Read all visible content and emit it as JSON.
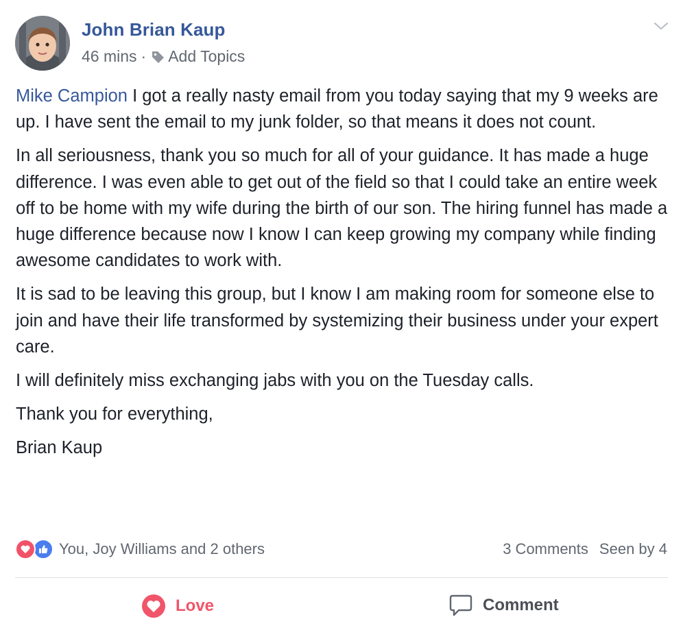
{
  "post": {
    "author": "John Brian Kaup",
    "timestamp": "46 mins",
    "separator": "·",
    "add_topics": "Add Topics",
    "mention": "Mike Campion",
    "paragraph1_rest": " I got a really nasty email from you today saying that my 9 weeks are up. I have sent the email to my junk folder, so that means it does not count.",
    "paragraph2": "In all seriousness, thank you so much for all of your guidance. It has made a huge difference. I was even able to get out of the field so that I could take an entire week off to be home with my wife during the birth of our son. The hiring funnel has made a huge difference because now I know I can keep growing my company while finding awesome candidates to work with.",
    "paragraph3": "It is sad to be leaving this group, but I know I am making room for someone else to join and have their life transformed by systemizing their business under your expert care.",
    "paragraph4": "I will definitely miss exchanging jabs with you on the Tuesday calls.",
    "paragraph5": "Thank you for everything,",
    "paragraph6": "Brian Kaup"
  },
  "reactions": {
    "summary": "You, Joy Williams and 2 others",
    "types": [
      "love",
      "like"
    ]
  },
  "stats": {
    "comments": "3 Comments",
    "seen_by": "Seen by 4"
  },
  "actions": {
    "love_label": "Love",
    "comment_label": "Comment"
  },
  "colors": {
    "link": "#365899",
    "love": "#f0556a",
    "like": "#4a7df0",
    "muted": "#616770"
  },
  "icons": {
    "tag": "tag-icon",
    "chevron": "chevron-down-icon",
    "love_reaction": "heart-icon",
    "like_reaction": "thumbs-up-icon",
    "comment": "speech-bubble-icon"
  }
}
